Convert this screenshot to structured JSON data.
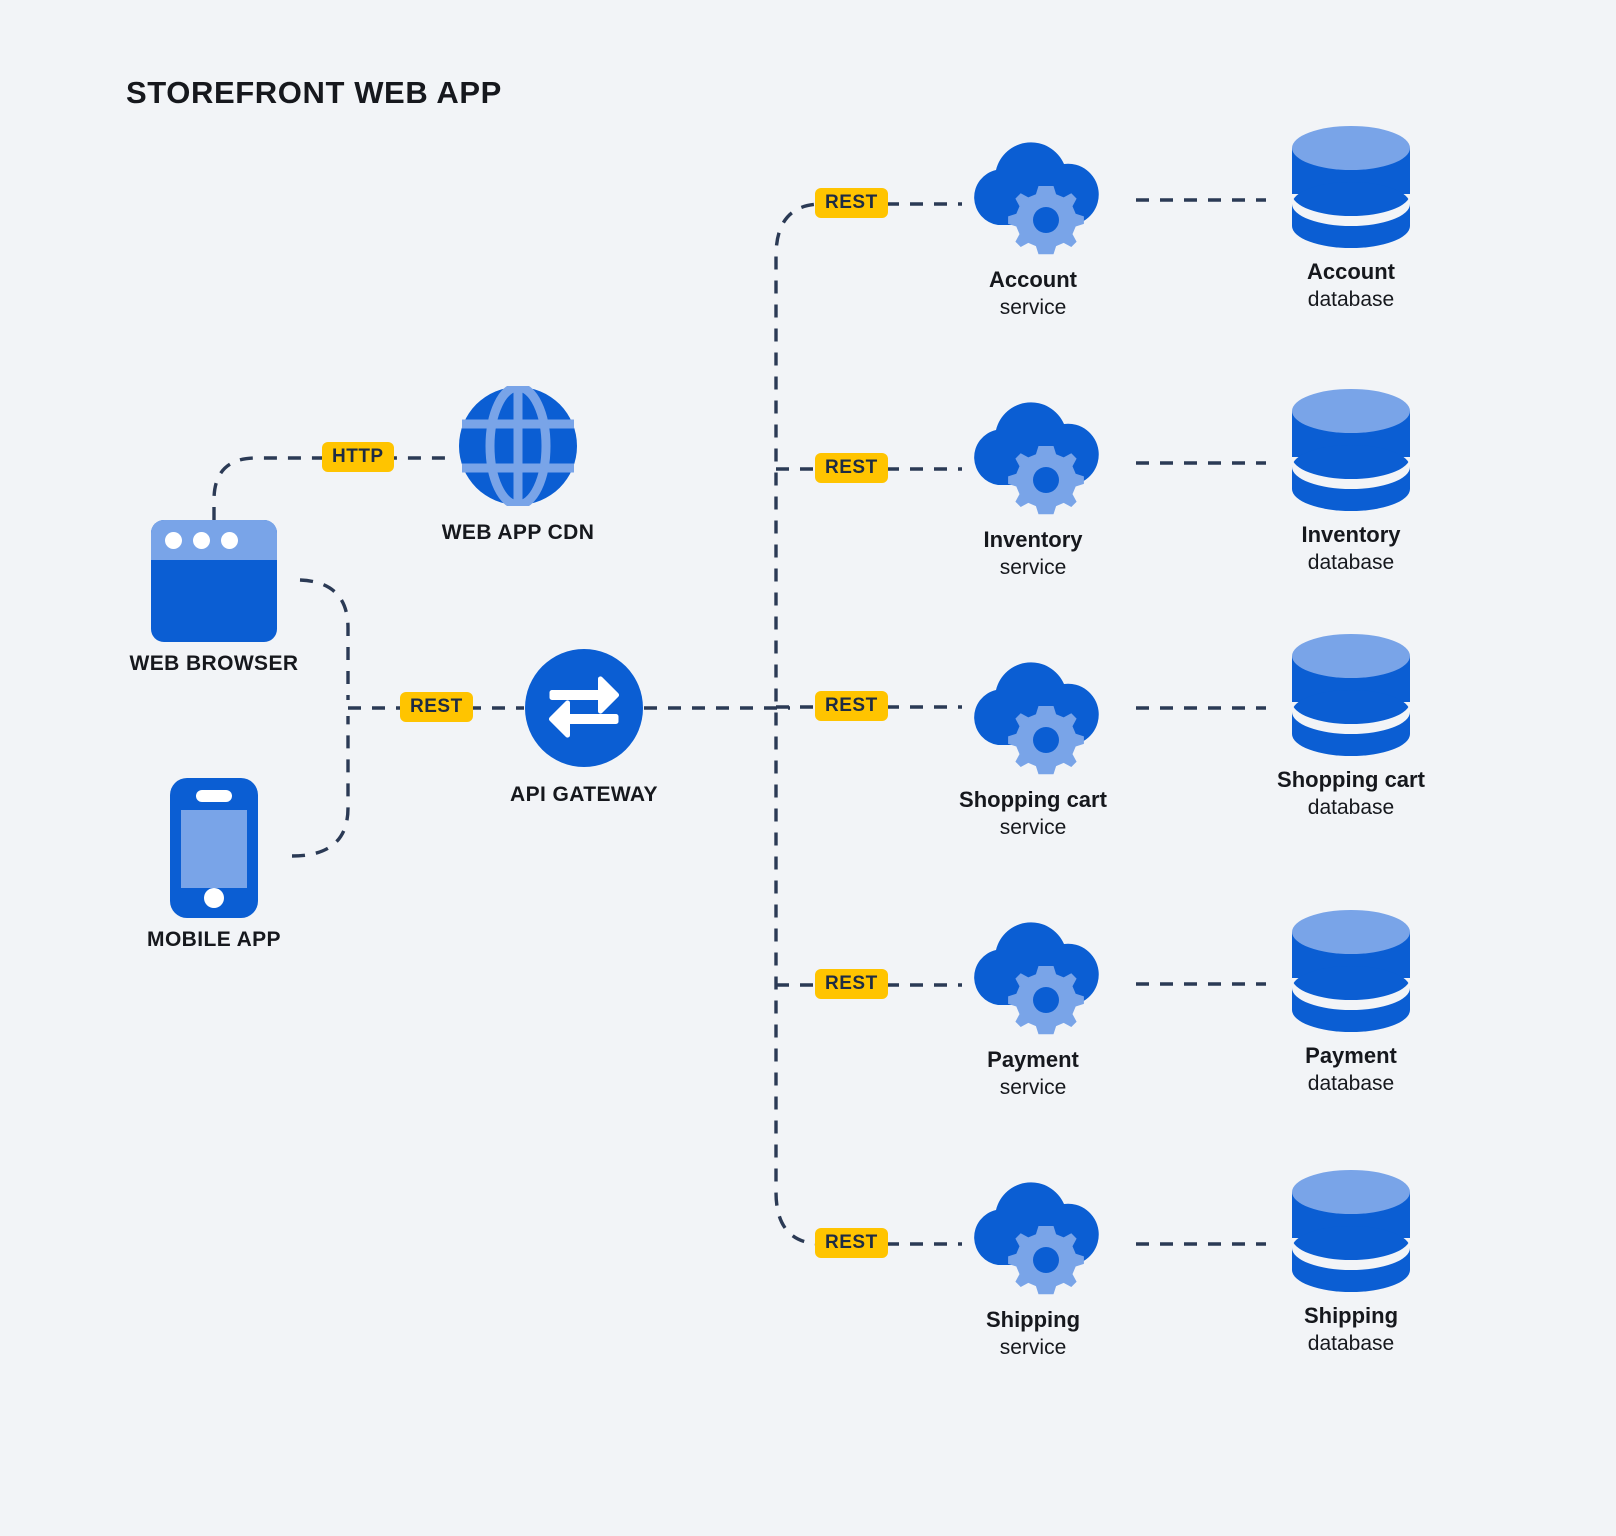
{
  "title": "STOREFRONT WEB APP",
  "colors": {
    "background": "#f2f4f7",
    "primary_blue": "#0b5ed3",
    "light_blue": "#79a4e8",
    "badge_yellow": "#ffc400",
    "badge_text": "#1d2b44",
    "line_navy": "#2b3a55",
    "text": "#16181d"
  },
  "clients": [
    {
      "id": "web-browser",
      "icon": "browser-icon",
      "label": "WEB BROWSER"
    },
    {
      "id": "mobile-app",
      "icon": "mobile-phone-icon",
      "label": "MOBILE APP"
    }
  ],
  "edge_nodes": [
    {
      "id": "web-app-cdn",
      "icon": "globe-icon",
      "label": "WEB APP CDN"
    },
    {
      "id": "api-gateway",
      "icon": "exchange-arrows-icon",
      "label": "API GATEWAY"
    }
  ],
  "services": [
    {
      "id": "account",
      "icon": "cloud-gear-icon",
      "name": "Account",
      "kind": "service"
    },
    {
      "id": "inventory",
      "icon": "cloud-gear-icon",
      "name": "Inventory",
      "kind": "service"
    },
    {
      "id": "shopping-cart",
      "icon": "cloud-gear-icon",
      "name": "Shopping cart",
      "kind": "service"
    },
    {
      "id": "payment",
      "icon": "cloud-gear-icon",
      "name": "Payment",
      "kind": "service"
    },
    {
      "id": "shipping",
      "icon": "cloud-gear-icon",
      "name": "Shipping",
      "kind": "service"
    }
  ],
  "databases": [
    {
      "id": "account-db",
      "icon": "database-cylinder-icon",
      "name": "Account",
      "kind": "database"
    },
    {
      "id": "inventory-db",
      "icon": "database-cylinder-icon",
      "name": "Inventory",
      "kind": "database"
    },
    {
      "id": "shopping-cart-db",
      "icon": "database-cylinder-icon",
      "name": "Shopping cart",
      "kind": "database"
    },
    {
      "id": "payment-db",
      "icon": "database-cylinder-icon",
      "name": "Payment",
      "kind": "database"
    },
    {
      "id": "shipping-db",
      "icon": "database-cylinder-icon",
      "name": "Shipping",
      "kind": "database"
    }
  ],
  "protocol_badges": [
    {
      "id": "browser-to-cdn",
      "label": "HTTP"
    },
    {
      "id": "clients-to-gateway",
      "label": "REST"
    },
    {
      "id": "gateway-to-account",
      "label": "REST"
    },
    {
      "id": "gateway-to-inventory",
      "label": "REST"
    },
    {
      "id": "gateway-to-cart",
      "label": "REST"
    },
    {
      "id": "gateway-to-payment",
      "label": "REST"
    },
    {
      "id": "gateway-to-shipping",
      "label": "REST"
    }
  ]
}
